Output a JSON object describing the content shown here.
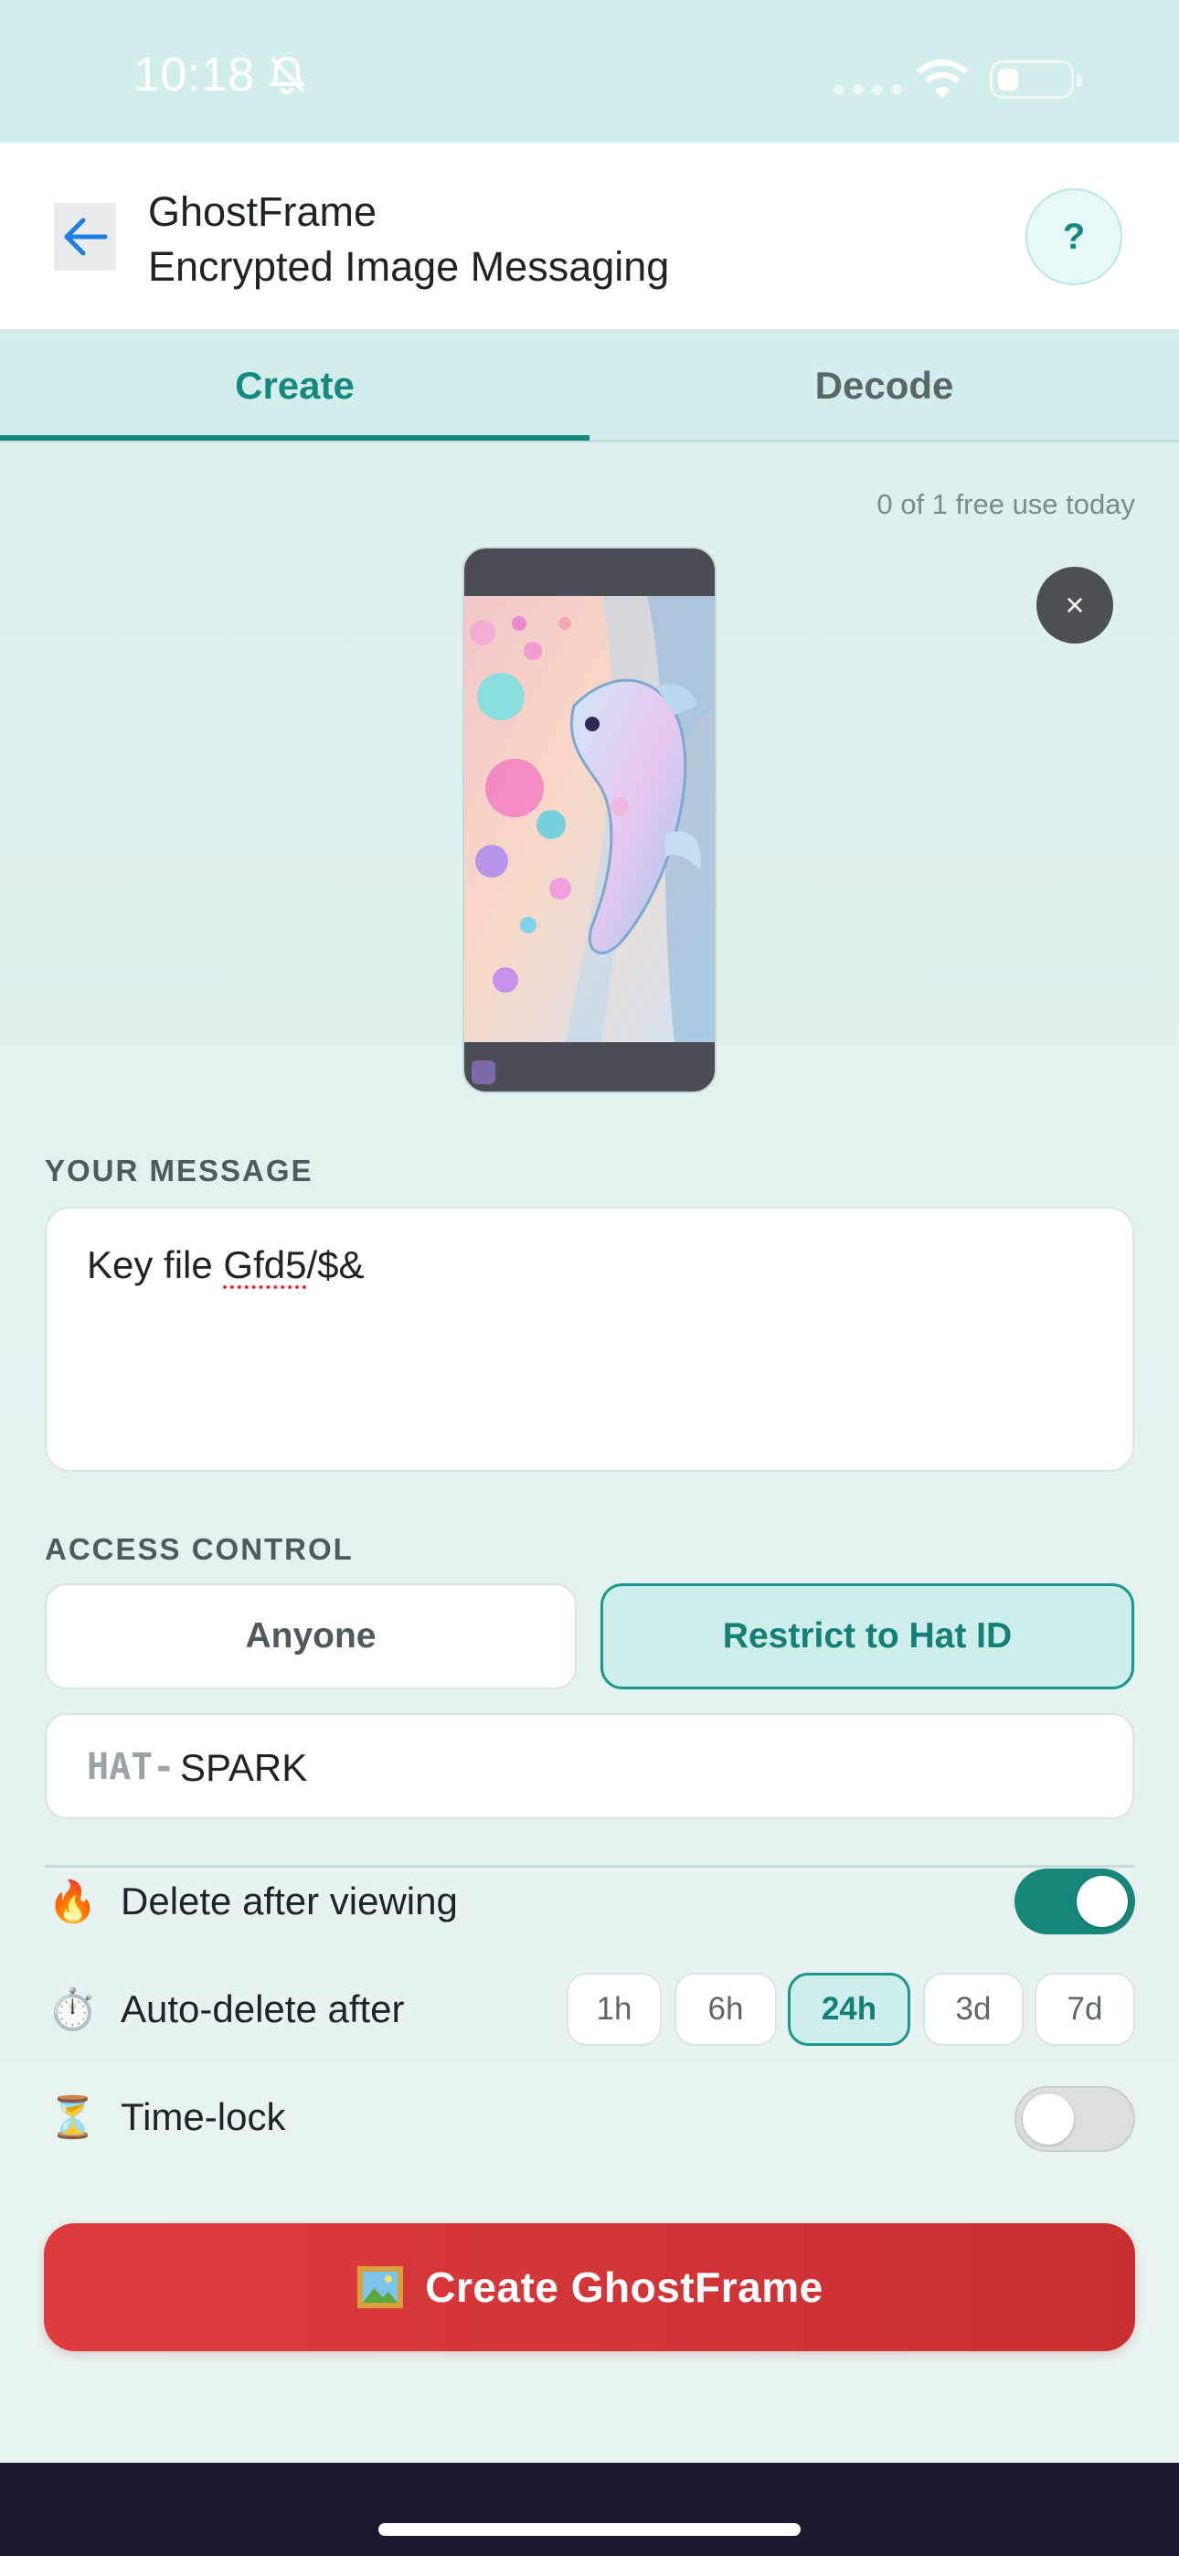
{
  "status_bar": {
    "time": "10:18"
  },
  "header": {
    "app_name": "GhostFrame",
    "subtitle": "Encrypted Image Messaging",
    "help_label": "?"
  },
  "tabs": [
    {
      "label": "Create",
      "active": true
    },
    {
      "label": "Decode",
      "active": false
    }
  ],
  "usage": {
    "text": "0 of 1 free use today"
  },
  "preview": {
    "close_label": "×"
  },
  "message": {
    "section_label": "YOUR MESSAGE",
    "value_plain": "Key file ",
    "value_flagged": "Gfd5",
    "value_tail": "/$&"
  },
  "access": {
    "section_label": "ACCESS CONTROL",
    "options": [
      "Anyone",
      "Restrict to Hat ID"
    ],
    "selected": "Restrict to Hat ID",
    "hat_prefix": "HAT-",
    "hat_value": "SPARK"
  },
  "options": {
    "delete_after_viewing": {
      "icon": "🔥",
      "label": "Delete after viewing",
      "enabled": true
    },
    "auto_delete": {
      "icon": "⏱️",
      "label": "Auto-delete after",
      "choices": [
        "1h",
        "6h",
        "24h",
        "3d",
        "7d"
      ],
      "selected": "24h"
    },
    "time_lock": {
      "icon": "⏳",
      "label": "Time-lock",
      "enabled": false
    }
  },
  "primary_action": {
    "label": "Create GhostFrame"
  },
  "colors": {
    "accent": "#16897e",
    "danger": "#d63639",
    "background": "#e2f2ef"
  }
}
